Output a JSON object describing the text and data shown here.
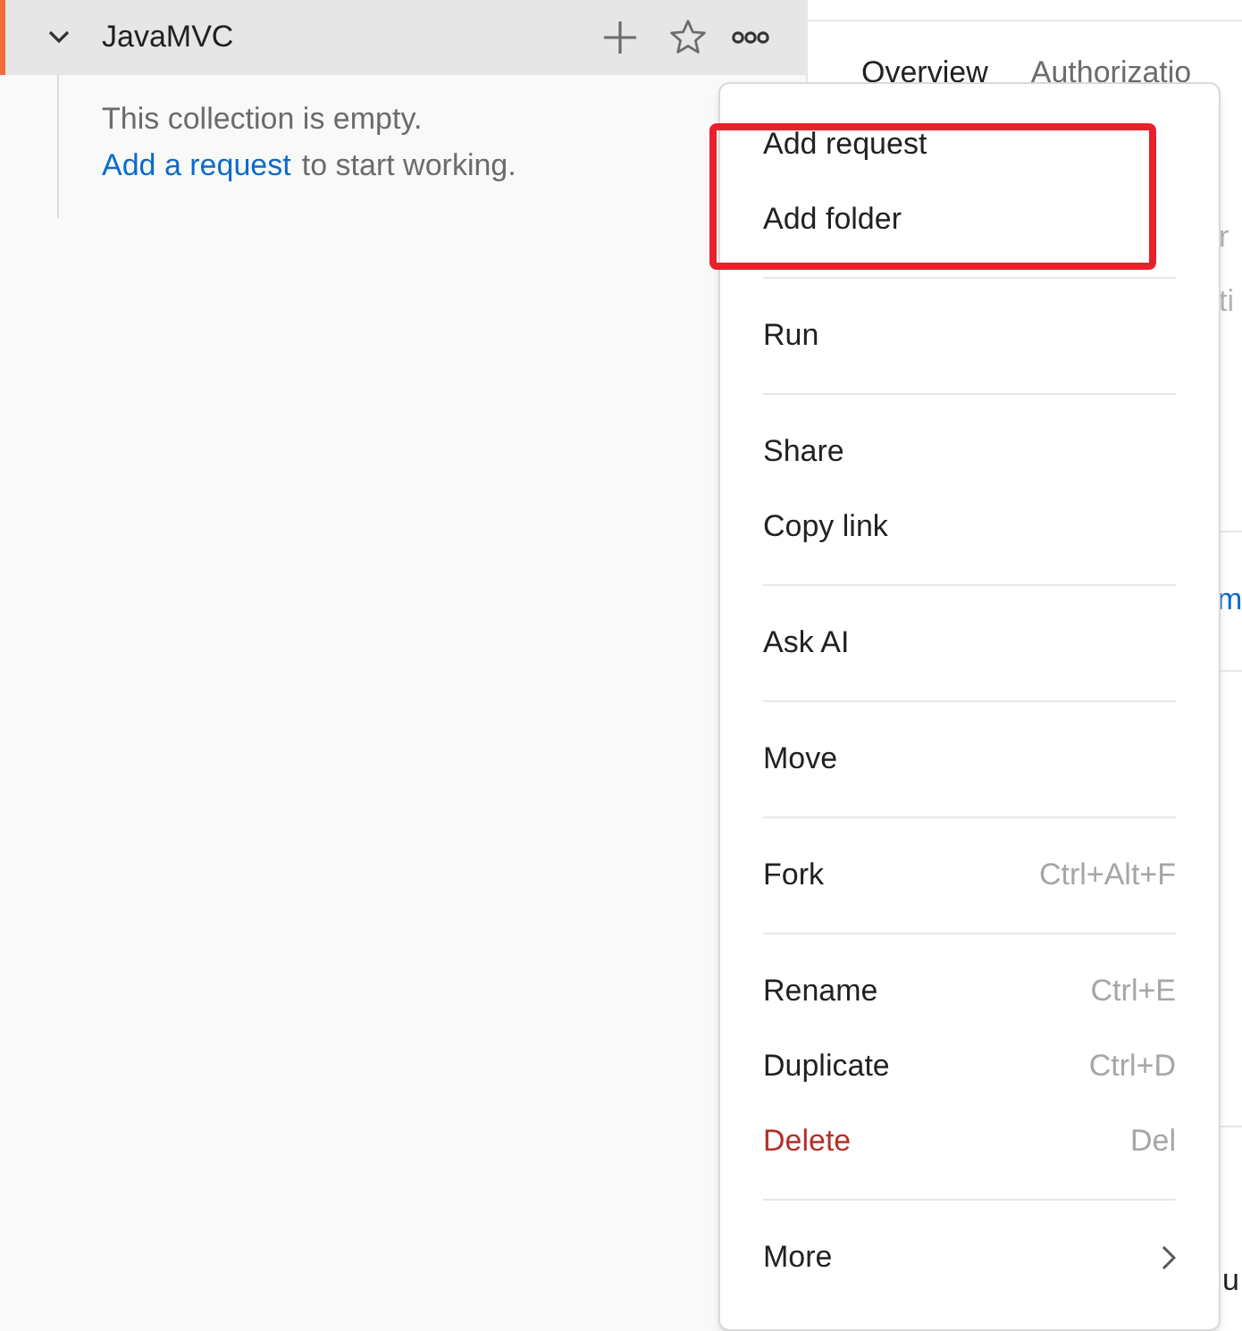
{
  "sidebar": {
    "collection": {
      "name": "JavaMVC",
      "expanded": true,
      "active": true
    },
    "empty_state": {
      "text": "This collection is empty.",
      "link": "Add a request",
      "suffix": "to start working."
    }
  },
  "tabs": [
    {
      "label": "Overview",
      "selected": true
    },
    {
      "label": "Authorizatio",
      "selected": false
    }
  ],
  "background_fragments": [
    {
      "text": "r",
      "kind": "muted"
    },
    {
      "text": "ti",
      "kind": "muted"
    },
    {
      "text": "m",
      "kind": "link"
    },
    {
      "text": "u",
      "kind": "plain"
    }
  ],
  "context_menu": {
    "groups": [
      {
        "highlighted": true,
        "items": [
          {
            "label": "Add request",
            "destructive": false,
            "submenu": false
          },
          {
            "label": "Add folder",
            "destructive": false,
            "submenu": false
          }
        ]
      },
      {
        "highlighted": false,
        "items": [
          {
            "label": "Run",
            "destructive": false,
            "submenu": false
          }
        ]
      },
      {
        "highlighted": false,
        "items": [
          {
            "label": "Share",
            "destructive": false,
            "submenu": false
          },
          {
            "label": "Copy link",
            "destructive": false,
            "submenu": false
          }
        ]
      },
      {
        "highlighted": false,
        "items": [
          {
            "label": "Ask AI",
            "destructive": false,
            "submenu": false
          }
        ]
      },
      {
        "highlighted": false,
        "items": [
          {
            "label": "Move",
            "destructive": false,
            "submenu": false
          }
        ]
      },
      {
        "highlighted": false,
        "items": [
          {
            "label": "Fork",
            "shortcut": "Ctrl+Alt+F",
            "destructive": false,
            "submenu": false
          }
        ]
      },
      {
        "highlighted": false,
        "items": [
          {
            "label": "Rename",
            "shortcut": "Ctrl+E",
            "destructive": false,
            "submenu": false
          },
          {
            "label": "Duplicate",
            "shortcut": "Ctrl+D",
            "destructive": false,
            "submenu": false
          },
          {
            "label": "Delete",
            "shortcut": "Del",
            "destructive": true,
            "submenu": false
          }
        ]
      },
      {
        "highlighted": false,
        "items": [
          {
            "label": "More",
            "destructive": false,
            "submenu": true
          }
        ]
      }
    ]
  }
}
